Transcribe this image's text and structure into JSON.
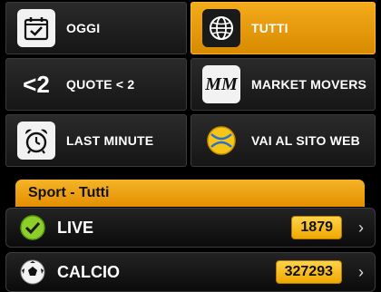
{
  "tiles": [
    {
      "label": "OGGI",
      "icon": "calendar-check-icon"
    },
    {
      "label": "TUTTI",
      "icon": "globe-icon"
    },
    {
      "label": "QUOTE < 2",
      "icon": "less-than-two-icon"
    },
    {
      "label": "MARKET MOVERS",
      "icon": "mm-logo-icon"
    },
    {
      "label": "LAST MINUTE",
      "icon": "alarm-clock-icon"
    },
    {
      "label": "VAI AL SITO WEB",
      "icon": "website-ball-icon"
    }
  ],
  "sport_header": "Sport - Tutti",
  "rows": [
    {
      "label": "LIVE",
      "count": "1879",
      "icon": "live-check-icon"
    },
    {
      "label": "CALCIO",
      "count": "327293",
      "icon": "soccer-ball-icon"
    }
  ],
  "colors": {
    "accent": "#f0a500",
    "live_green": "#8ccf2a",
    "background": "#000000"
  },
  "icon_glyphs": {
    "chevron": "›",
    "less_than_two": "<2",
    "mm": "MM"
  }
}
